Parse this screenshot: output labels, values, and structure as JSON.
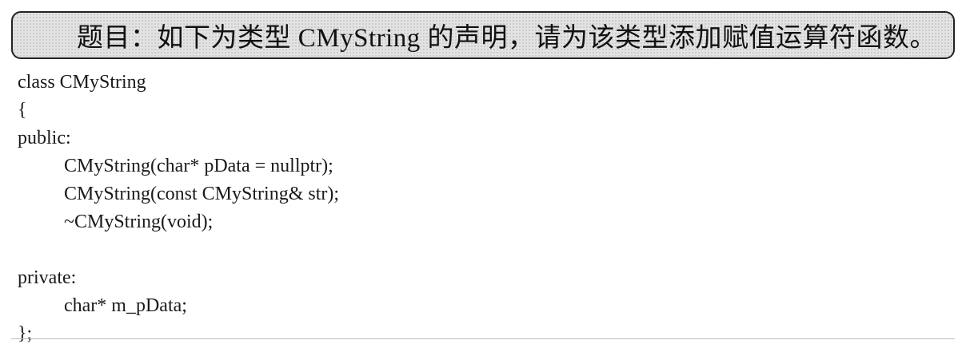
{
  "title": "题目：如下为类型 CMyString 的声明，请为该类型添加赋值运算符函数。",
  "code_lines": [
    "class CMyString",
    "{",
    "public:",
    "CMyString(char* pData = nullptr);",
    "CMyString(const CMyString& str);",
    "~CMyString(void);",
    "",
    "private:",
    "char* m_pData;",
    "};"
  ]
}
